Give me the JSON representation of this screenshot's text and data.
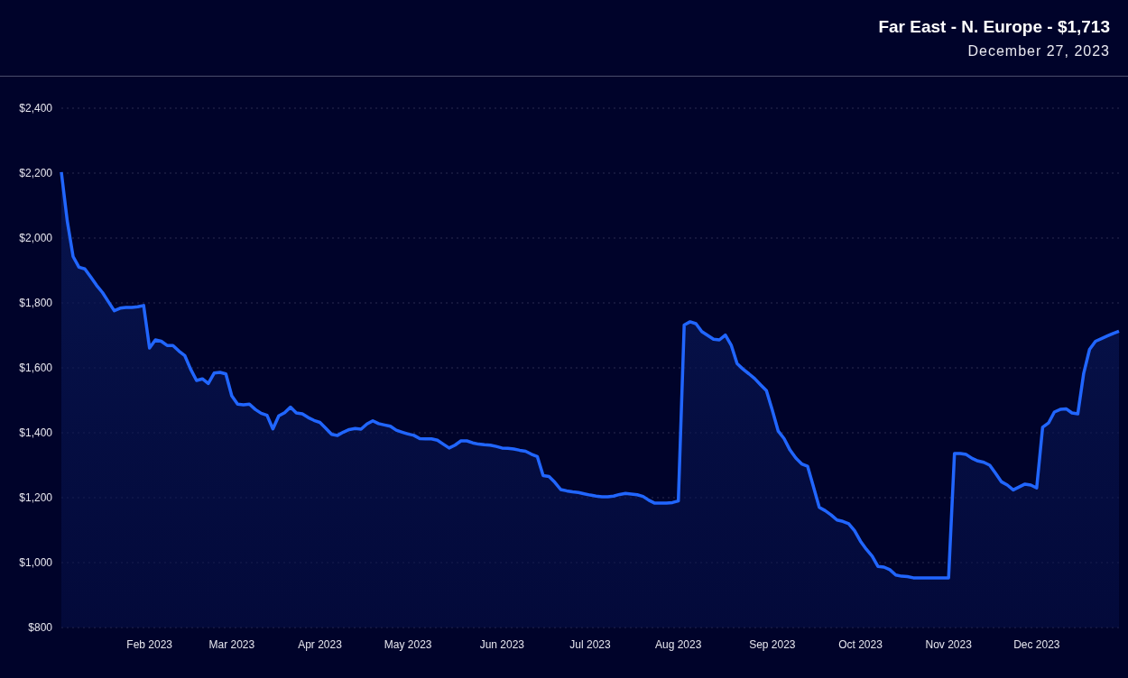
{
  "header": {
    "title": "Far East - N. Europe - $1,713",
    "date": "December 27, 2023"
  },
  "chart": {
    "chart_data": {
      "type": "area",
      "grid": true,
      "ylim": [
        800,
        2400
      ],
      "yticks": [
        {
          "value": 800,
          "label": "$800"
        },
        {
          "value": 1000,
          "label": "$1,000"
        },
        {
          "value": 1200,
          "label": "$1,200"
        },
        {
          "value": 1400,
          "label": "$1,400"
        },
        {
          "value": 1600,
          "label": "$1,600"
        },
        {
          "value": 1800,
          "label": "$1,800"
        },
        {
          "value": 2000,
          "label": "$2,000"
        },
        {
          "value": 2200,
          "label": "$2,200"
        },
        {
          "value": 2400,
          "label": "$2,400"
        }
      ],
      "categories": [
        null,
        null,
        null,
        null,
        null,
        null,
        null,
        null,
        null,
        null,
        null,
        null,
        null,
        null,
        null,
        "Feb 2023",
        null,
        null,
        null,
        null,
        null,
        null,
        null,
        null,
        null,
        null,
        null,
        null,
        null,
        "Mar 2023",
        null,
        null,
        null,
        null,
        null,
        null,
        null,
        null,
        null,
        null,
        null,
        null,
        null,
        null,
        "Apr 2023",
        null,
        null,
        null,
        null,
        null,
        null,
        null,
        null,
        null,
        null,
        null,
        null,
        null,
        null,
        "May 2023",
        null,
        null,
        null,
        null,
        null,
        null,
        null,
        null,
        null,
        null,
        null,
        null,
        null,
        null,
        null,
        "Jun 2023",
        null,
        null,
        null,
        null,
        null,
        null,
        null,
        null,
        null,
        null,
        null,
        null,
        null,
        null,
        "Jul 2023",
        null,
        null,
        null,
        null,
        null,
        null,
        null,
        null,
        null,
        null,
        null,
        null,
        null,
        null,
        "Aug 2023",
        null,
        null,
        null,
        null,
        null,
        null,
        null,
        null,
        null,
        null,
        null,
        null,
        null,
        null,
        null,
        "Sep 2023",
        null,
        null,
        null,
        null,
        null,
        null,
        null,
        null,
        null,
        null,
        null,
        null,
        null,
        null,
        "Oct 2023",
        null,
        null,
        null,
        null,
        null,
        null,
        null,
        null,
        null,
        null,
        null,
        null,
        null,
        null,
        "Nov 2023",
        null,
        null,
        null,
        null,
        null,
        null,
        null,
        null,
        null,
        null,
        null,
        null,
        null,
        null,
        "Dec 2023",
        null,
        null,
        null,
        null,
        null,
        null,
        null,
        null,
        null,
        null,
        null,
        null,
        null,
        null
      ],
      "values": [
        2203,
        2053,
        1943,
        1910,
        1905,
        1880,
        1854,
        1832,
        1804,
        1776,
        1784,
        1786,
        1786,
        1788,
        1792,
        1661,
        1686,
        1682,
        1669,
        1669,
        1652,
        1638,
        1596,
        1561,
        1566,
        1552,
        1584,
        1586,
        1581,
        1514,
        1488,
        1486,
        1488,
        1472,
        1460,
        1454,
        1412,
        1452,
        1462,
        1479,
        1461,
        1458,
        1447,
        1438,
        1432,
        1414,
        1395,
        1392,
        1402,
        1410,
        1413,
        1411,
        1427,
        1437,
        1428,
        1424,
        1420,
        1408,
        1402,
        1396,
        1392,
        1382,
        1381,
        1381,
        1377,
        1365,
        1353,
        1362,
        1375,
        1375,
        1369,
        1365,
        1363,
        1362,
        1358,
        1353,
        1352,
        1350,
        1346,
        1343,
        1334,
        1327,
        1268,
        1265,
        1247,
        1225,
        1221,
        1218,
        1216,
        1212,
        1208,
        1205,
        1203,
        1203,
        1205,
        1210,
        1213,
        1211,
        1209,
        1204,
        1192,
        1183,
        1183,
        1183,
        1185,
        1190,
        1732,
        1742,
        1736,
        1712,
        1700,
        1688,
        1686,
        1701,
        1670,
        1613,
        1596,
        1582,
        1567,
        1548,
        1530,
        1470,
        1405,
        1382,
        1347,
        1322,
        1304,
        1297,
        1234,
        1170,
        1160,
        1147,
        1131,
        1127,
        1120,
        1098,
        1066,
        1041,
        1020,
        988,
        986,
        978,
        962,
        958,
        957,
        953,
        953,
        953,
        953,
        953,
        953,
        953,
        1336,
        1336,
        1333,
        1321,
        1313,
        1309,
        1300,
        1275,
        1249,
        1239,
        1224,
        1233,
        1242,
        1239,
        1230,
        1417,
        1430,
        1464,
        1472,
        1474,
        1461,
        1458,
        1583,
        1657,
        1682,
        1690,
        1698,
        1706,
        1713
      ]
    }
  }
}
